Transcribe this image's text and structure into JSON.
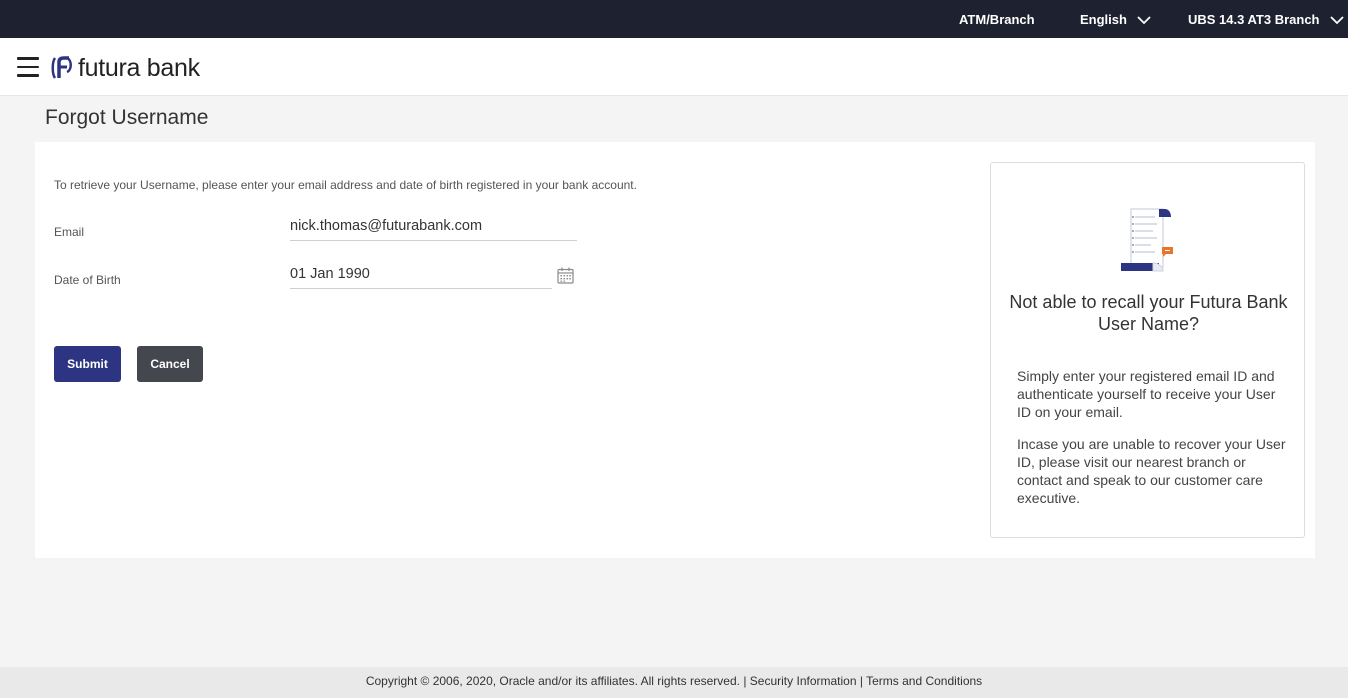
{
  "topbar": {
    "atm_branch": "ATM/Branch",
    "language": "English",
    "entity": "UBS 14.3 AT3 Branch"
  },
  "header": {
    "logo_text": "futura bank"
  },
  "page": {
    "title": "Forgot Username"
  },
  "form": {
    "instruction": "To retrieve your Username, please enter your email address and date of birth registered in your bank account.",
    "email_label": "Email",
    "email_value": "nick.thomas@futurabank.com",
    "dob_label": "Date of Birth",
    "dob_value": "01 Jan 1990",
    "submit_label": "Submit",
    "cancel_label": "Cancel"
  },
  "help": {
    "title": "Not able to recall your Futura Bank User Name?",
    "para1": "Simply enter your registered email ID and authenticate yourself to receive your User ID on your email.",
    "para2": "Incase you are unable to recover your User ID, please visit our nearest branch or contact and speak to our customer care executive."
  },
  "footer": {
    "copyright": "Copyright © 2006, 2020, Oracle and/or its affiliates. All rights reserved.",
    "separator": "|",
    "security_link": "Security Information",
    "terms_link": "Terms and Conditions"
  },
  "colors": {
    "topbar_bg": "#1e2230",
    "primary_button": "#2d3583",
    "secondary_button": "#45474f",
    "page_bg": "#f4f4f4",
    "accent_orange": "#e8752a"
  },
  "icons": {
    "menu": "hamburger-icon",
    "language_dropdown": "chevron-down-icon",
    "entity_dropdown": "chevron-down-icon",
    "calendar": "calendar-icon",
    "help_illustration": "document-scroll-icon",
    "logo": "futura-logo-icon"
  }
}
